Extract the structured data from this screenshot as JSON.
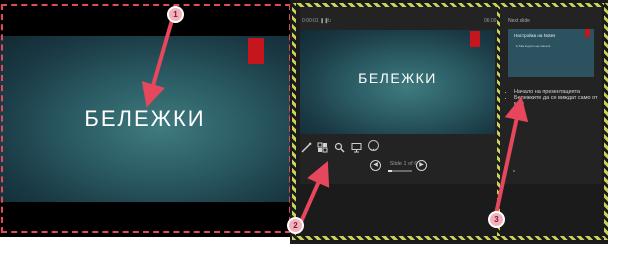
{
  "audience_view": {
    "slide_title": "БЕЛЕЖКИ"
  },
  "presenter_view": {
    "timer": "0:00:01",
    "clock": "06:09",
    "current_slide_title": "БЕЛЕЖКИ",
    "next_slide_label": "Next slide",
    "next_slide_heading": "Настройка на Notes",
    "next_slide_subtext": "● Там където ще пишете",
    "notes": [
      "Начало на презентацията",
      "Бележките да се виждат само от мен"
    ],
    "slide_counter": "Slide 1 of 6",
    "progress_fraction": 0.17,
    "tools": [
      "pen-icon",
      "slides-grid-icon",
      "zoom-icon",
      "screen-icon",
      "more-icon"
    ],
    "nav": [
      "prev-slide-icon",
      "next-slide-icon"
    ]
  },
  "markers": [
    "1",
    "2",
    "3"
  ],
  "colors": {
    "slide_dark": "#122a33",
    "slide_accent": "#3f7b7f",
    "red_accent": "#c4161c",
    "marker_fill": "#f3b1bb",
    "dash_red": "#e24a5a",
    "hatch_yellow": "#c9d35a"
  }
}
